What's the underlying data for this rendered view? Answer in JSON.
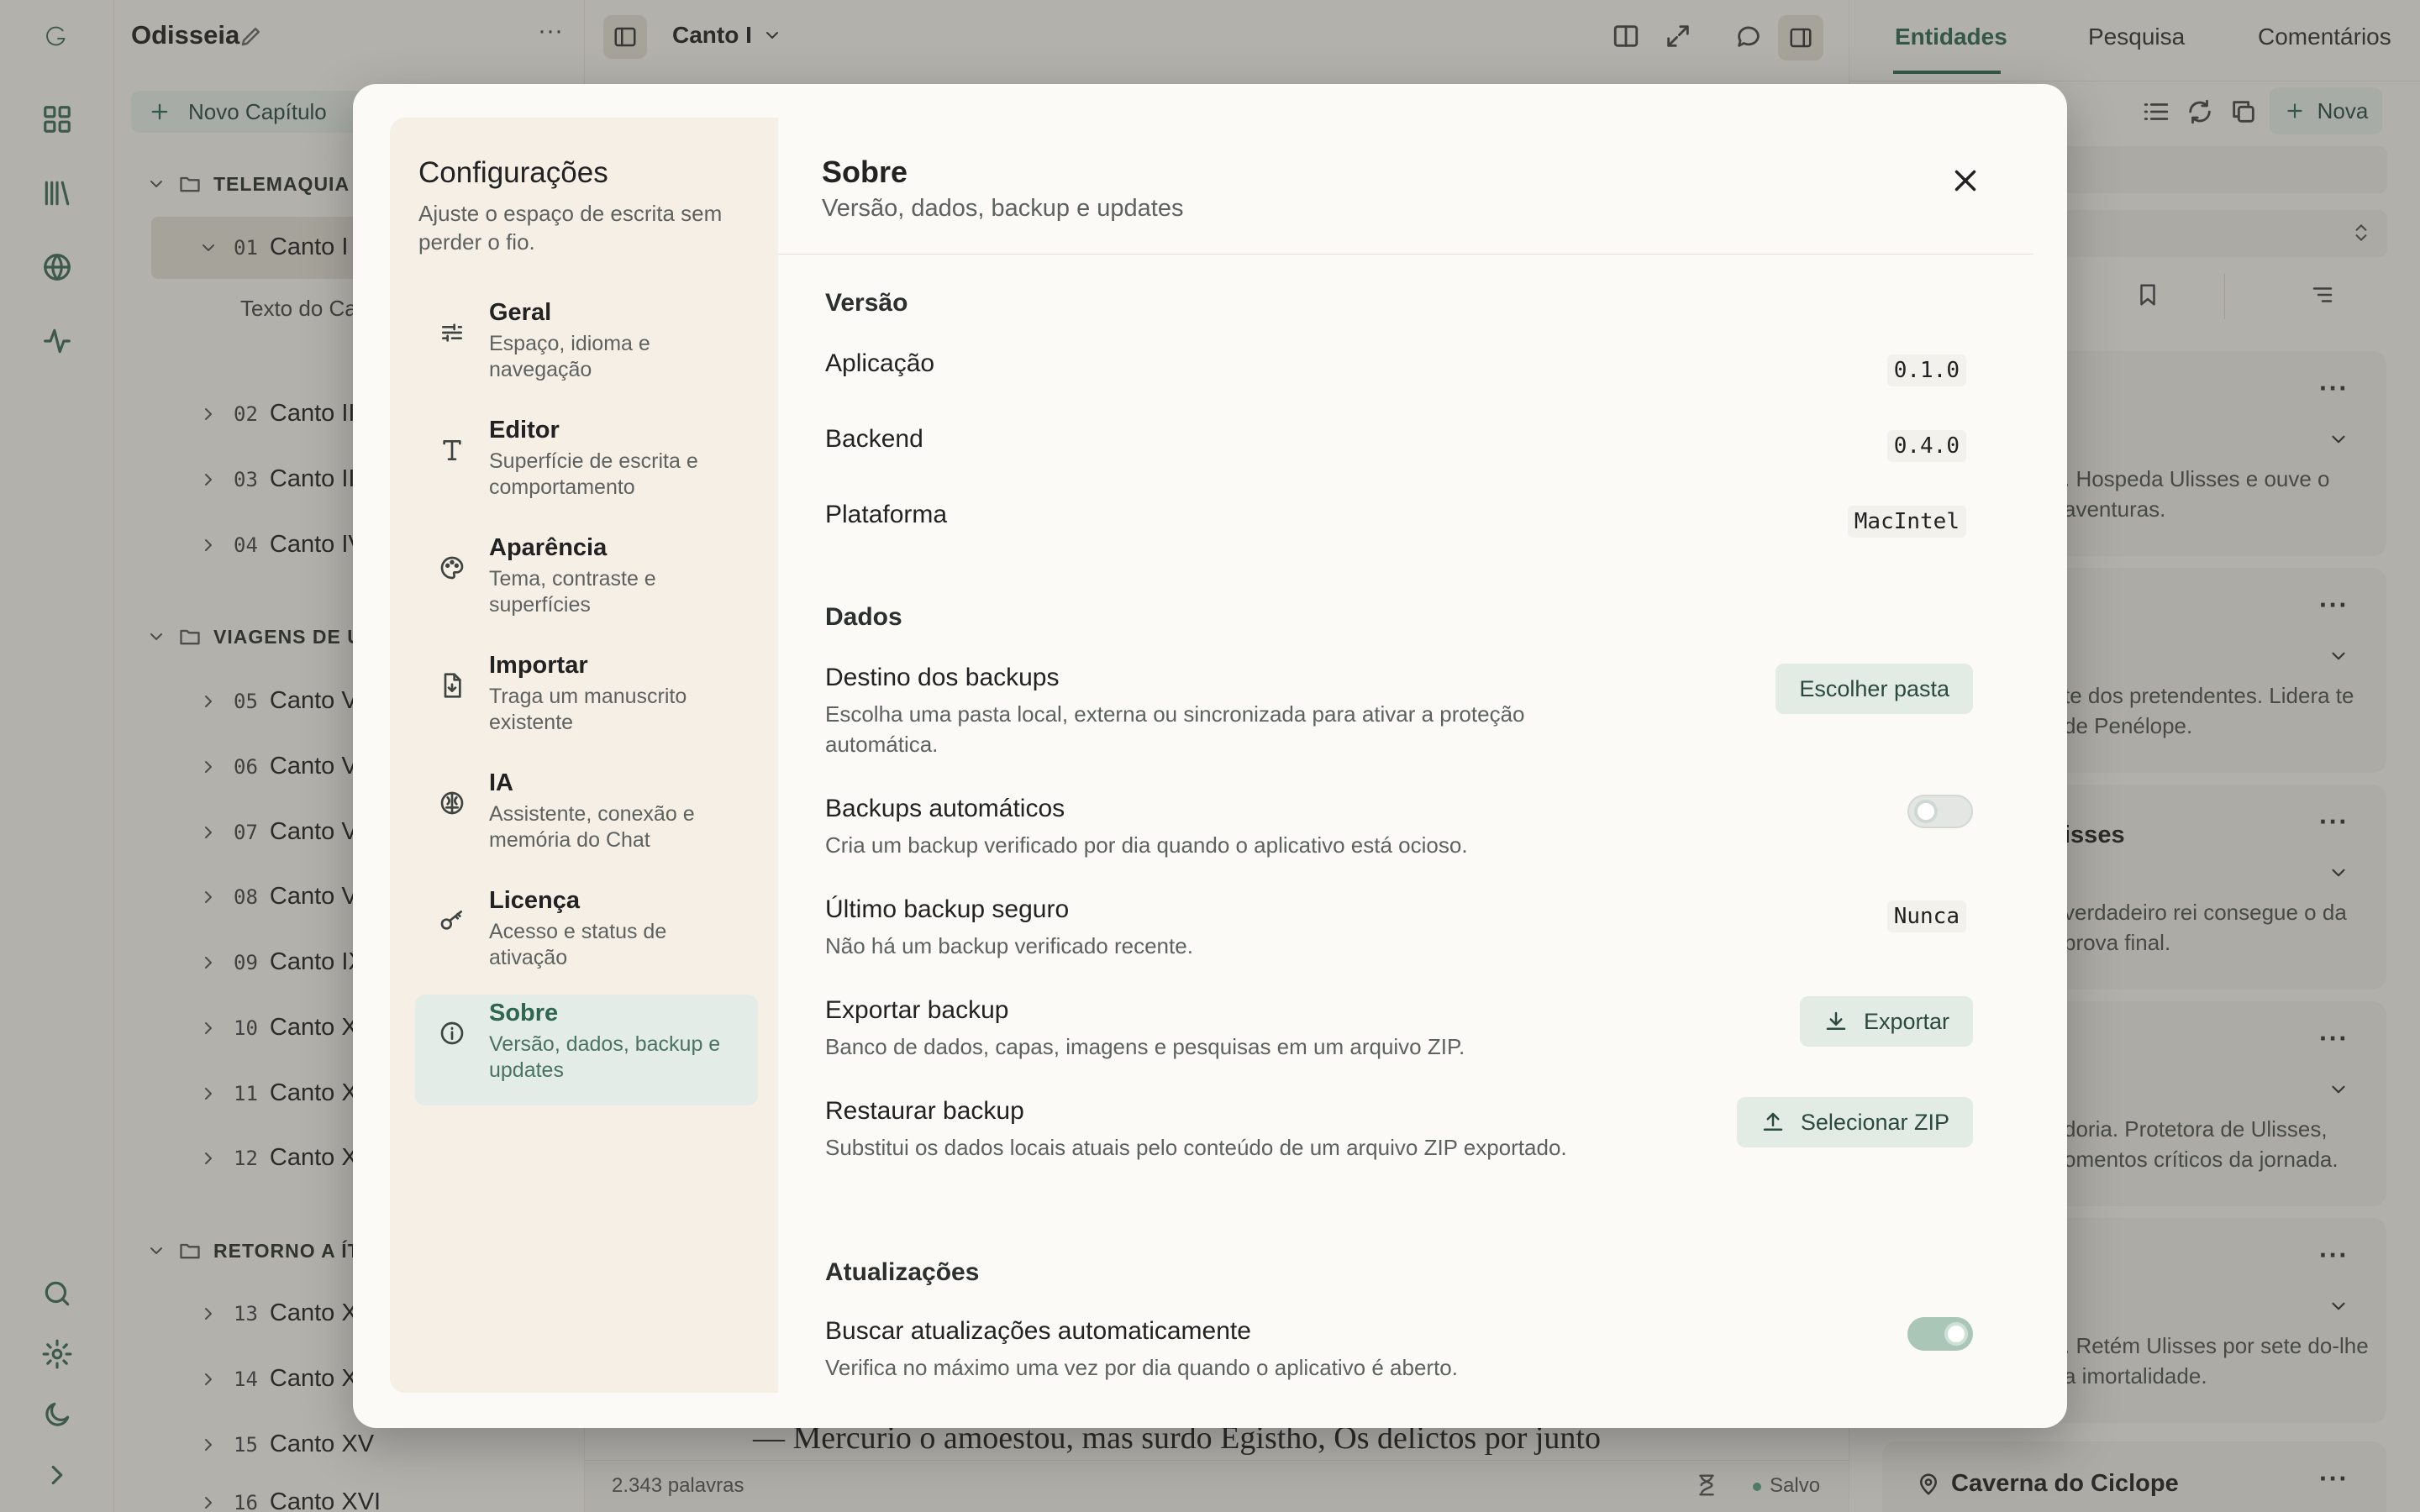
{
  "project": {
    "title": "Odisseia",
    "new_chapter": "Novo Capítulo"
  },
  "tree": {
    "groups": [
      {
        "label": "TELEMAQUIA"
      },
      {
        "label": "VIAGENS DE U"
      },
      {
        "label": "RETORNO A ÍT"
      }
    ],
    "items": [
      {
        "num": "01",
        "label": "Canto I"
      },
      {
        "sub": "Texto do Ca"
      },
      {
        "num": "02",
        "label": "Canto II"
      },
      {
        "num": "03",
        "label": "Canto II"
      },
      {
        "num": "04",
        "label": "Canto IV"
      },
      {
        "num": "05",
        "label": "Canto V"
      },
      {
        "num": "06",
        "label": "Canto V"
      },
      {
        "num": "07",
        "label": "Canto V"
      },
      {
        "num": "08",
        "label": "Canto V"
      },
      {
        "num": "09",
        "label": "Canto IX"
      },
      {
        "num": "10",
        "label": "Canto X"
      },
      {
        "num": "11",
        "label": "Canto X"
      },
      {
        "num": "12",
        "label": "Canto X"
      },
      {
        "num": "13",
        "label": "Canto X"
      },
      {
        "num": "14",
        "label": "Canto X"
      },
      {
        "num": "15",
        "label": "Canto XV"
      },
      {
        "num": "16",
        "label": "Canto XVI"
      }
    ]
  },
  "main": {
    "chapter": "Canto I",
    "editor_text": "— Mercurio o amoestou, mas surdo Egistho, Os delictos por junto",
    "word_count": "2.343 palavras",
    "saved": "Salvo"
  },
  "right": {
    "tabs": [
      "Entidades",
      "Pesquisa",
      "Comentários"
    ],
    "new_label": "Nova",
    "cards": [
      {
        "text": ". Hospeda Ulisses e ouve o aventuras."
      },
      {
        "text": "te dos pretendentes. Lidera te de Penélope."
      },
      {
        "title": "isses",
        "text": "verdadeiro rei consegue o da prova final."
      },
      {
        "text": "doria. Protetora de Ulisses, omentos críticos da jornada."
      },
      {
        "text": ". Retém Ulisses por sete do-lhe a imortalidade."
      }
    ],
    "last_title": "Caverna do Ciclope"
  },
  "settings": {
    "title": "Configurações",
    "subtitle": "Ajuste o espaço de escrita sem perder o fio.",
    "nav": [
      {
        "title": "Geral",
        "desc": "Espaço, idioma e navegação",
        "icon": "sliders-icon"
      },
      {
        "title": "Editor",
        "desc": "Superfície de escrita e comportamento",
        "icon": "type-icon"
      },
      {
        "title": "Aparência",
        "desc": "Tema, contraste e superfícies",
        "icon": "palette-icon"
      },
      {
        "title": "Importar",
        "desc": "Traga um manuscrito existente",
        "icon": "file-import-icon"
      },
      {
        "title": "IA",
        "desc": "Assistente, conexão e memória do Chat",
        "icon": "brain-icon"
      },
      {
        "title": "Licença",
        "desc": "Acesso e status de ativação",
        "icon": "key-icon"
      },
      {
        "title": "Sobre",
        "desc": "Versão, dados, backup e updates",
        "icon": "info-icon"
      }
    ],
    "panel": {
      "title": "Sobre",
      "subtitle": "Versão, dados, backup e updates",
      "version": {
        "heading": "Versão",
        "app_label": "Aplicação",
        "app": "0.1.0",
        "backend_label": "Backend",
        "backend": "0.4.0",
        "platform_label": "Plataforma",
        "platform": "MacIntel"
      },
      "data": {
        "heading": "Dados",
        "dest_label": "Destino dos backups",
        "dest_desc": "Escolha uma pasta local, externa ou sincronizada para ativar a proteção automática.",
        "dest_btn": "Escolher pasta",
        "auto_label": "Backups automáticos",
        "auto_desc": "Cria um backup verificado por dia quando o aplicativo está ocioso.",
        "auto_on": false,
        "last_label": "Último backup seguro",
        "last_desc": "Não há um backup verificado recente.",
        "last_value": "Nunca",
        "export_label": "Exportar backup",
        "export_desc": "Banco de dados, capas, imagens e pesquisas em um arquivo ZIP.",
        "export_btn": "Exportar",
        "restore_label": "Restaurar backup",
        "restore_desc": "Substitui os dados locais atuais pelo conteúdo de um arquivo ZIP exportado.",
        "restore_btn": "Selecionar ZIP"
      },
      "updates": {
        "heading": "Atualizações",
        "auto_label": "Buscar atualizações automaticamente",
        "auto_desc": "Verifica no máximo uma vez por dia quando o aplicativo é aberto.",
        "auto_on": true
      }
    }
  },
  "colors": {
    "accent": "#2e6652",
    "active_bg": "#e3ece6",
    "button_bg": "#e2ebe4"
  }
}
